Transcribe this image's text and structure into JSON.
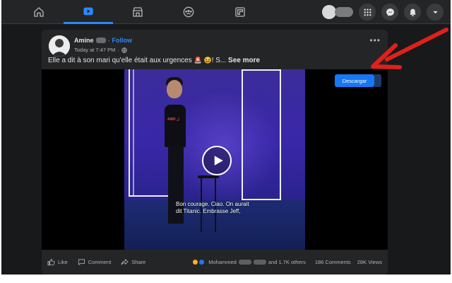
{
  "nav": {
    "tabs": [
      {
        "name": "home",
        "icon": "home-icon"
      },
      {
        "name": "watch",
        "icon": "watch-icon",
        "active": true
      },
      {
        "name": "marketplace",
        "icon": "marketplace-icon"
      },
      {
        "name": "groups",
        "icon": "groups-icon"
      },
      {
        "name": "gaming",
        "icon": "gaming-icon"
      }
    ],
    "right_icons": [
      "menu-grid-icon",
      "messenger-icon",
      "notifications-icon",
      "account-dropdown-icon"
    ]
  },
  "post": {
    "author": "Amine",
    "follow_label": "Follow",
    "timestamp": "Today at 7:47 PM",
    "separator": "·",
    "text": "Elle a dit à son mari qu'elle était aux urgences ",
    "text_tail": "! S...",
    "see_more": "See more",
    "video": {
      "shirt_text": "AMO ل",
      "subtitle": "Bon courage. Ciao. On aurait\ndit Titanic. Embrasse Jeff,",
      "download_label": "Descargar"
    },
    "actions": {
      "like": "Like",
      "comment": "Comment",
      "share": "Share"
    },
    "reactions": {
      "first_name": "Mohammed",
      "others": "and 1.7K others",
      "comments": "186 Comments",
      "views": "28K Views"
    }
  },
  "colors": {
    "accent": "#2d88ff",
    "download_button": "#1877f2",
    "annotation_arrow": "#e0201b",
    "card_bg": "#242526",
    "page_bg": "#18191a"
  }
}
